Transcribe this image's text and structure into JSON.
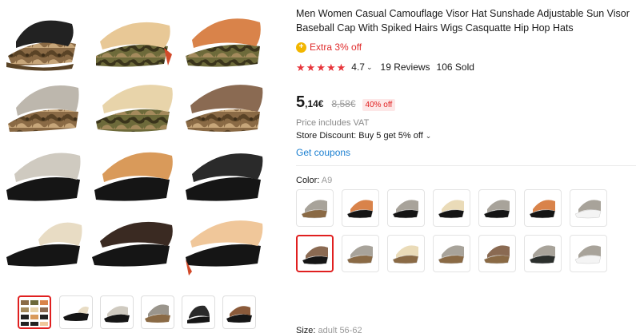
{
  "product": {
    "title": "Men Women Casual Camouflage Visor Hat Sunshade Adjustable Sun Visor Baseball Cap With Spiked Hairs Wigs Casquatte Hip Hop Hats",
    "coupon_icon": "coin-icon",
    "coupon_text": "Extra 3% off",
    "stars": 5,
    "rating": "4.7",
    "reviews": "19 Reviews",
    "sold": "106 Sold",
    "price_main": "5",
    "price_sub": ",14€",
    "price_old": "8,58€",
    "discount": "40% off",
    "vat_note": "Price includes VAT",
    "store_discount": "Store Discount: Buy 5 get 5% off",
    "get_coupons": "Get coupons",
    "color_label": "Color:",
    "color_value": "A9",
    "size_label": "Size:",
    "size_value": "adult 56-62"
  },
  "colors": {
    "accent_red": "#e02020",
    "star_red": "#e8353b",
    "link_blue": "#1b7fd0",
    "coin_yellow": "#f2b600"
  },
  "gallery": {
    "thumbnails": [
      "grid-thumb",
      "black-visor-blonde",
      "black-cap-gray",
      "camo-gray",
      "black-cap-dark",
      "black-visor-brown"
    ],
    "active_index": 0
  },
  "swatches": [
    {
      "name": "A1",
      "hat": "camo",
      "hair": "gray"
    },
    {
      "name": "A2",
      "hat": "black",
      "hair": "orange"
    },
    {
      "name": "A3",
      "hat": "black",
      "hair": "gray"
    },
    {
      "name": "A4",
      "hat": "black",
      "hair": "blonde"
    },
    {
      "name": "A5",
      "hat": "black",
      "hair": "gray"
    },
    {
      "name": "A6",
      "hat": "black",
      "hair": "orange"
    },
    {
      "name": "A7",
      "hat": "white",
      "hair": "gray"
    },
    {
      "name": "A9",
      "hat": "black",
      "hair": "brown"
    },
    {
      "name": "A10",
      "hat": "camo",
      "hair": "gray"
    },
    {
      "name": "A11",
      "hat": "camo",
      "hair": "blonde"
    },
    {
      "name": "A12",
      "hat": "camo",
      "hair": "gray"
    },
    {
      "name": "A13",
      "hat": "camo",
      "hair": "brown"
    },
    {
      "name": "A14",
      "hat": "dark",
      "hair": "gray"
    },
    {
      "name": "A15",
      "hat": "white",
      "hair": "gray"
    }
  ],
  "selected_swatch": 7
}
